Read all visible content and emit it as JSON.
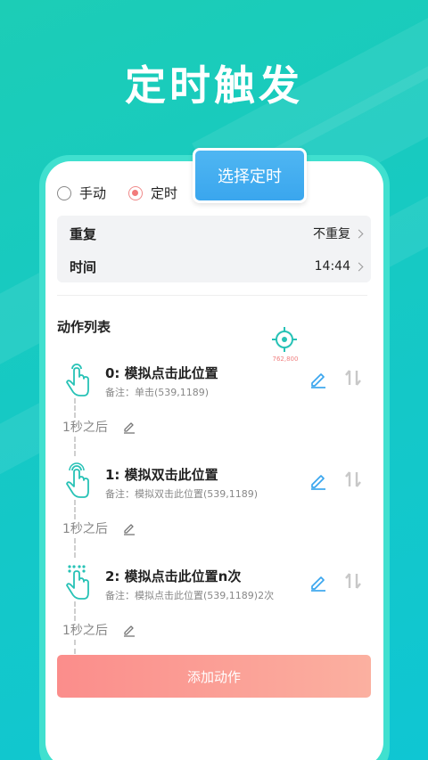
{
  "promo": {
    "title": "定时触发"
  },
  "callout": {
    "label": "选择定时"
  },
  "trigger_mode": {
    "options": [
      {
        "label": "手动",
        "selected": false
      },
      {
        "label": "定时",
        "selected": true
      }
    ]
  },
  "settings": {
    "repeat": {
      "label": "重复",
      "value": "不重复"
    },
    "time": {
      "label": "时间",
      "value": "14:44"
    }
  },
  "action_list": {
    "title": "动作列表",
    "target_coords": "762,800",
    "actions": [
      {
        "title": "0: 模拟点击此位置",
        "note": "备注：单击(539,1189)",
        "icon": "single-tap-hand-icon"
      },
      {
        "title": "1: 模拟双击此位置",
        "note": "备注：模拟双击此位置(539,1189)",
        "icon": "double-tap-hand-icon"
      },
      {
        "title": "2: 模拟点击此位置n次",
        "note": "备注：模拟点击此位置(539,1189)2次",
        "icon": "multi-tap-hand-icon"
      }
    ],
    "delays": [
      "1秒之后",
      "1秒之后",
      "1秒之后"
    ]
  },
  "add_button": {
    "label": "添加动作"
  },
  "colors": {
    "accent_teal": "#1ccdb6",
    "action_blue": "#3aa6ee",
    "radio_red": "#f27b7b",
    "button_gradient_start": "#fb8d8b",
    "button_gradient_end": "#fbb0a0"
  }
}
